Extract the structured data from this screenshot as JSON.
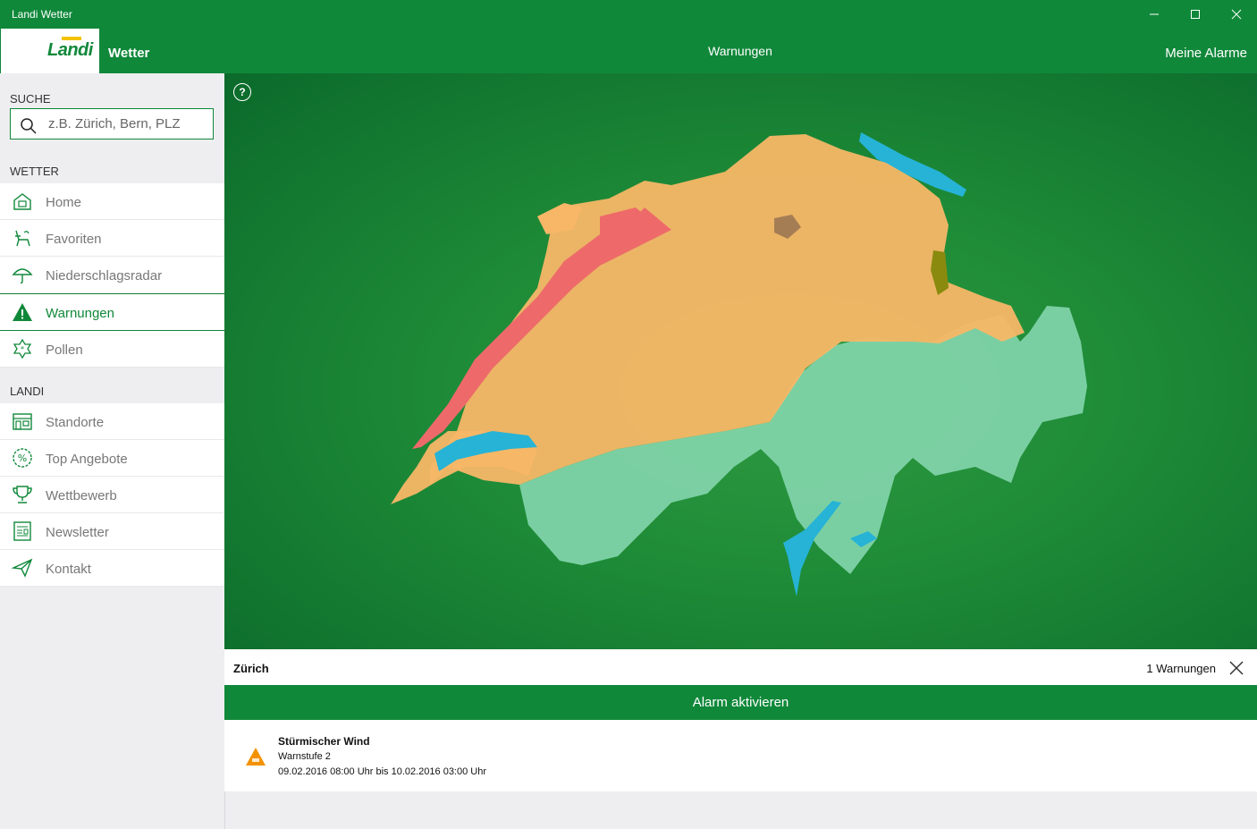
{
  "window": {
    "title": "Landi Wetter"
  },
  "header": {
    "logo_text": "Landi",
    "app_title": "Wetter",
    "page_title": "Warnungen",
    "alarms_link": "Meine Alarme"
  },
  "sidebar": {
    "search_section": "SUCHE",
    "search_placeholder": "z.B. Zürich, Bern, PLZ",
    "weather_section": "WETTER",
    "weather_items": [
      {
        "label": "Home",
        "icon": "house-icon"
      },
      {
        "label": "Favoriten",
        "icon": "chair-icon"
      },
      {
        "label": "Niederschlagsradar",
        "icon": "umbrella-icon"
      },
      {
        "label": "Warnungen",
        "icon": "warning-icon",
        "active": true
      },
      {
        "label": "Pollen",
        "icon": "flower-icon"
      }
    ],
    "landi_section": "LANDI",
    "landi_items": [
      {
        "label": "Standorte",
        "icon": "store-icon"
      },
      {
        "label": "Top Angebote",
        "icon": "percent-icon"
      },
      {
        "label": "Wettbewerb",
        "icon": "trophy-icon"
      },
      {
        "label": "Newsletter",
        "icon": "newspaper-icon"
      },
      {
        "label": "Kontakt",
        "icon": "paper-plane-icon"
      }
    ]
  },
  "map": {
    "help_label": "?",
    "colors": {
      "level1": "#7fd3a8",
      "level2": "#f7b767",
      "level3": "#ee6a6a",
      "lake": "#26b3d6"
    }
  },
  "detail": {
    "location": "Zürich",
    "warning_count": "1 Warnungen",
    "alarm_button": "Alarm aktivieren",
    "warning": {
      "title": "Stürmischer Wind",
      "level": "Warnstufe 2",
      "period": "09.02.2016 08:00 Uhr bis 10.02.2016 03:00 Uhr",
      "color": "#f39200"
    }
  },
  "colors": {
    "brand_green": "#10883a",
    "sidebar_bg": "#eeeef1"
  }
}
